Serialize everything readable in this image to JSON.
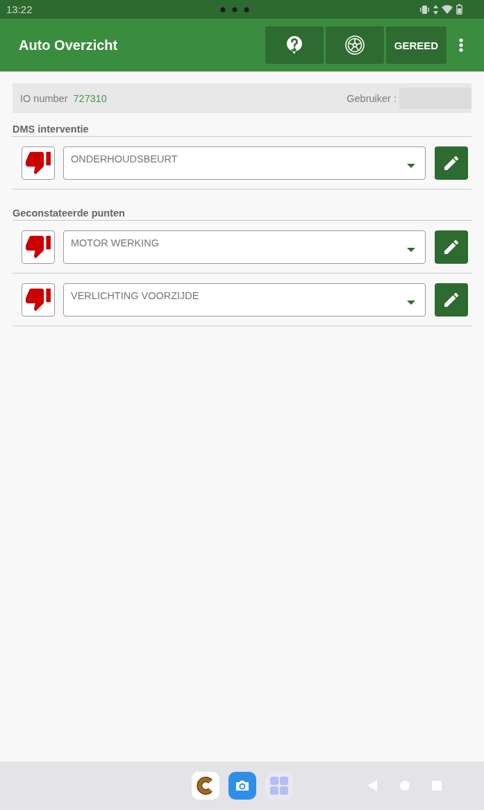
{
  "status_bar": {
    "time": "13:22"
  },
  "app_bar": {
    "title": "Auto Overzicht",
    "done_label": "GEREED"
  },
  "info_bar": {
    "io_label": "IO number",
    "io_value": "727310",
    "user_label": "Gebruiker :"
  },
  "sections": [
    {
      "title": "DMS interventie",
      "items": [
        {
          "value": "ONDERHOUDSBEURT",
          "approved": false
        }
      ]
    },
    {
      "title": "Geconstateerde punten",
      "items": [
        {
          "value": "MOTOR WERKING",
          "approved": false
        },
        {
          "value": "VERLICHTING VOORZIJDE",
          "approved": false
        }
      ]
    }
  ]
}
